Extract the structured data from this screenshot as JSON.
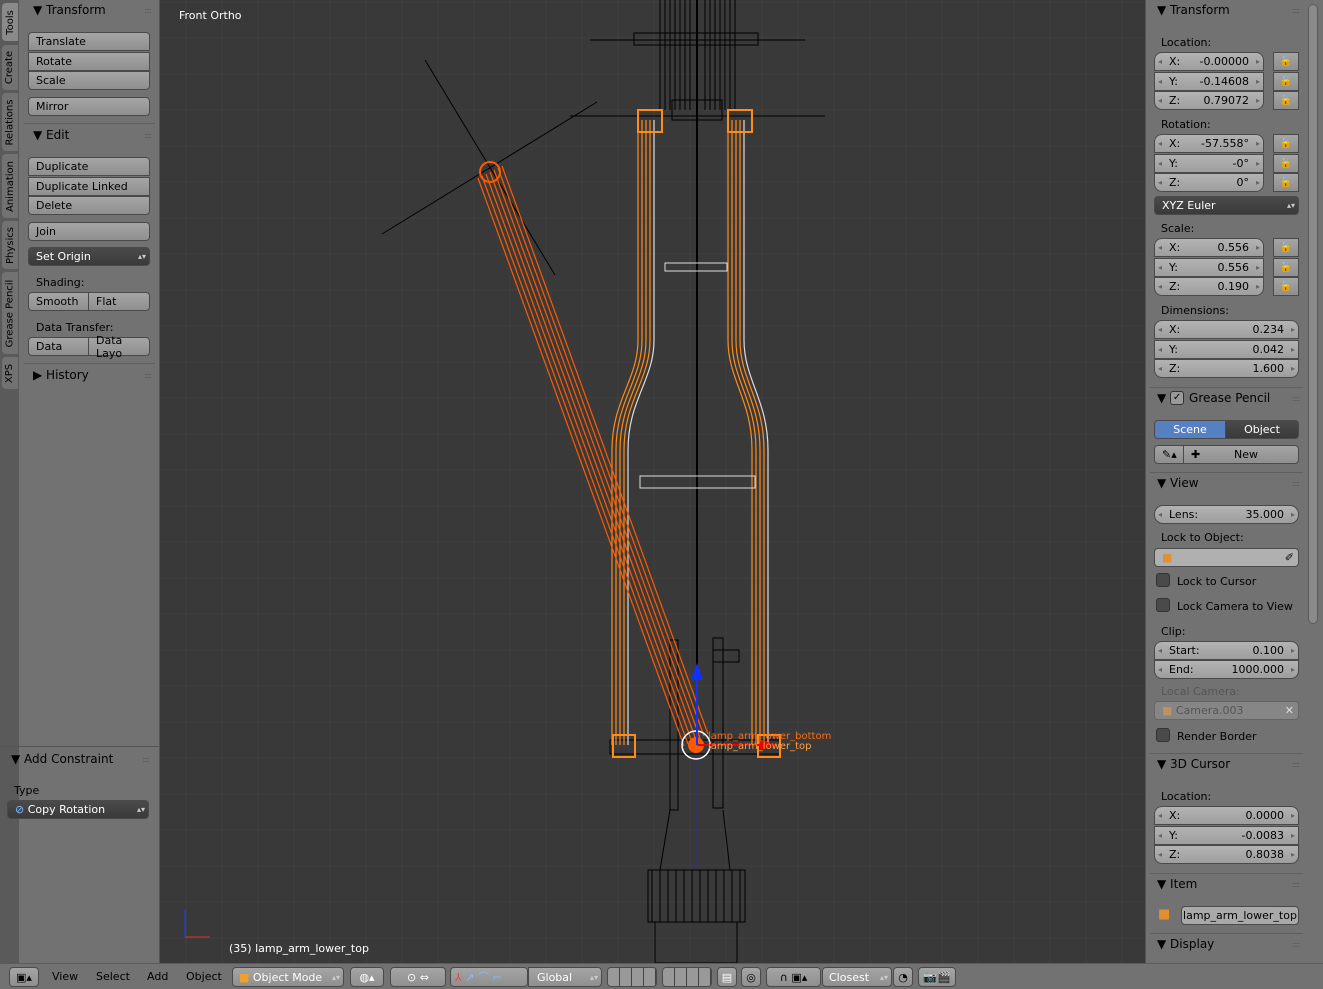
{
  "tool_tabs": [
    "Tools",
    "Create",
    "Relations",
    "Animation",
    "Physics",
    "Grease Pencil",
    "XPS"
  ],
  "shelf": {
    "transform": {
      "title": "Transform",
      "buttons": [
        "Translate",
        "Rotate",
        "Scale"
      ],
      "mirror": "Mirror"
    },
    "edit": {
      "title": "Edit",
      "buttons": [
        "Duplicate",
        "Duplicate Linked",
        "Delete"
      ],
      "join": "Join",
      "set_origin": "Set Origin",
      "shading_label": "Shading:",
      "smooth": "Smooth",
      "flat": "Flat",
      "data_transfer_label": "Data Transfer:",
      "data": "Data",
      "data_layout": "Data Layo"
    },
    "history": {
      "title": "History"
    },
    "operator": {
      "title": "Add Constraint",
      "type_label": "Type",
      "type_value": "Copy Rotation"
    }
  },
  "viewport": {
    "view_name": "Front Ortho",
    "object_info": "(35) lamp_arm_lower_top",
    "labels": [
      "lamp_arm_lower_bottom",
      "lamp_arm_lower_top"
    ],
    "colors": {
      "selected": "#ff8c1a",
      "active": "#ff5a00",
      "background": "#393939"
    }
  },
  "props": {
    "transform": {
      "title": "Transform",
      "location_label": "Location:",
      "location": [
        [
          "X:",
          "-0.00000"
        ],
        [
          "Y:",
          "-0.14608"
        ],
        [
          "Z:",
          "0.79072"
        ]
      ],
      "rotation_label": "Rotation:",
      "rotation": [
        [
          "X:",
          "-57.558°"
        ],
        [
          "Y:",
          "-0°"
        ],
        [
          "Z:",
          "0°"
        ]
      ],
      "rotation_mode": "XYZ Euler",
      "scale_label": "Scale:",
      "scale": [
        [
          "X:",
          "0.556"
        ],
        [
          "Y:",
          "0.556"
        ],
        [
          "Z:",
          "0.190"
        ]
      ],
      "dimensions_label": "Dimensions:",
      "dimensions": [
        [
          "X:",
          "0.234"
        ],
        [
          "Y:",
          "0.042"
        ],
        [
          "Z:",
          "1.600"
        ]
      ]
    },
    "grease_pencil": {
      "title": "Grease Pencil",
      "enabled": true,
      "scene": "Scene",
      "object": "Object",
      "new": "New"
    },
    "view": {
      "title": "View",
      "lens_label": "Lens:",
      "lens": "35.000",
      "lock_object_label": "Lock to Object:",
      "lock_cursor": "Lock to Cursor",
      "lock_camera": "Lock Camera to View",
      "clip_label": "Clip:",
      "start_label": "Start:",
      "start": "0.100",
      "end_label": "End:",
      "end": "1000.000",
      "local_camera_label": "Local Camera:",
      "local_camera": "Camera.003",
      "render_border": "Render Border"
    },
    "cursor": {
      "title": "3D Cursor",
      "location_label": "Location:",
      "location": [
        [
          "X:",
          "0.0000"
        ],
        [
          "Y:",
          "-0.0083"
        ],
        [
          "Z:",
          "0.8038"
        ]
      ]
    },
    "item": {
      "title": "Item",
      "name": "lamp_arm_lower_top"
    },
    "display": {
      "title": "Display"
    }
  },
  "header": {
    "menus": [
      "View",
      "Select",
      "Add",
      "Object"
    ],
    "mode": "Object Mode",
    "orientation": "Global",
    "snap": "Closest"
  }
}
